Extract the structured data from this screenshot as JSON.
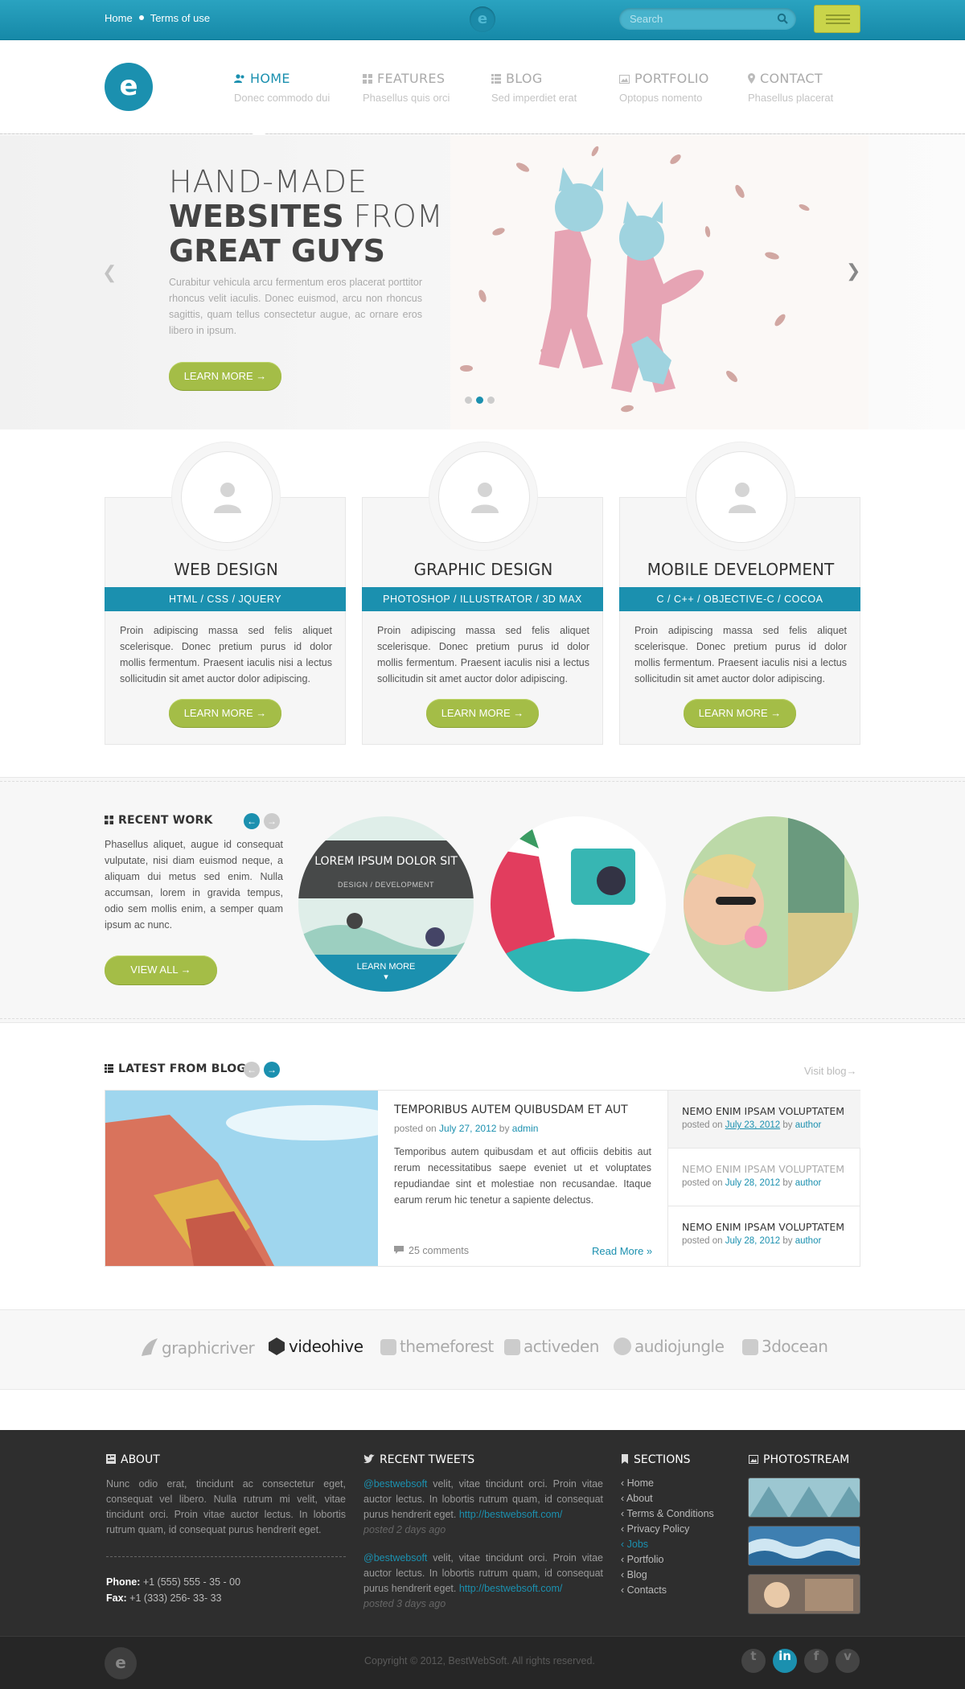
{
  "topbar": {
    "home": "Home",
    "terms": "Terms of use",
    "search_placeholder": "Search",
    "logo_letter": "e"
  },
  "header": {
    "logo_letter": "e"
  },
  "nav": [
    {
      "label": "HOME",
      "sub": "Donec commodo dui"
    },
    {
      "label": "FEATURES",
      "sub": "Phasellus quis orci"
    },
    {
      "label": "BLOG",
      "sub": "Sed imperdiet erat"
    },
    {
      "label": "PORTFOLIO",
      "sub": "Optopus nomento"
    },
    {
      "label": "CONTACT",
      "sub": "Phasellus placerat"
    }
  ],
  "slider": {
    "line1": "HAND-MADE",
    "line2_bold": "WEBSITES",
    "line2_rest": " FROM",
    "line3": "GREAT GUYS",
    "text": "Curabitur vehicula arcu fermentum eros placerat porttitor rhoncus velit iaculis. Donec euismod, arcu non rhoncus sagittis, quam tellus consectetur augue, ac ornare eros libero in ipsum.",
    "button": "LEARN MORE →"
  },
  "services": [
    {
      "title": "WEB DESIGN",
      "tags": "HTML / CSS / JQUERY",
      "text": "Proin adipiscing massa sed felis aliquet scelerisque. Donec pretium purus id dolor mollis fermentum. Praesent iaculis nisi a lectus sollicitudin sit amet auctor dolor adipiscing.",
      "button": "LEARN MORE →"
    },
    {
      "title": "GRAPHIC DESIGN",
      "tags": "PHOTOSHOP / ILLUSTRATOR / 3D MAX",
      "text": "Proin adipiscing massa sed felis aliquet scelerisque. Donec pretium purus id dolor mollis fermentum. Praesent iaculis nisi a lectus sollicitudin sit amet auctor dolor adipiscing.",
      "button": "LEARN MORE →"
    },
    {
      "title": "MOBILE DEVELOPMENT",
      "tags": "C / C++ / OBJECTIVE-C / COCOA",
      "text": "Proin adipiscing massa sed felis aliquet scelerisque. Donec pretium purus id dolor mollis fermentum. Praesent iaculis nisi a lectus sollicitudin sit amet auctor dolor adipiscing.",
      "button": "LEARN MORE →"
    }
  ],
  "recent_work": {
    "heading": "RECENT WORK",
    "text": "Phasellus aliquet, augue id consequat vulputate, nisi diam euismod neque, a aliquam dui metus sed enim. Nulla accumsan, lorem in gravida tempus, odio sem mollis enim, a semper quam ipsum ac nunc.",
    "button": "VIEW ALL →",
    "overlay_title": "LOREM IPSUM DOLOR SIT",
    "overlay_sub": "DESIGN / DEVELOPMENT",
    "overlay_button": "LEARN MORE"
  },
  "blog": {
    "heading": "LATEST FROM BLOG",
    "visit": "Visit blog→",
    "main": {
      "title": "TEMPORIBUS AUTEM QUIBUSDAM ET AUT",
      "posted_on": "posted on ",
      "date": "July 27, 2012",
      "by": " by ",
      "author": "admin",
      "text": "Temporibus autem quibusdam et aut officiis debitis aut rerum necessitatibus saepe eveniet ut et voluptates repudiandae sint et molestiae non recusandae. Itaque earum rerum hic tenetur a sapiente delectus.",
      "comments": "25 comments",
      "read_more": "Read More »"
    },
    "side": [
      {
        "title": "NEMO ENIM IPSAM VOLUPTATEM",
        "posted_on": "posted on ",
        "date": "July 23, 2012",
        "by": " by ",
        "author": "author"
      },
      {
        "title": "NEMO ENIM IPSAM VOLUPTATEM",
        "posted_on": "posted on ",
        "date": "July 28, 2012",
        "by": " by ",
        "author": "author"
      },
      {
        "title": "NEMO ENIM IPSAM VOLUPTATEM",
        "posted_on": "posted on ",
        "date": "July 28, 2012",
        "by": " by ",
        "author": "author"
      }
    ]
  },
  "brands": [
    "graphicriver",
    "videohive",
    "themeforest",
    "activeden",
    "audiojungle",
    "3docean"
  ],
  "footer": {
    "about": {
      "heading": "ABOUT",
      "text": "Nunc odio erat, tincidunt ac consectetur eget, consequat vel libero. Nulla rutrum mi velit, vitae tincidunt orci. Proin vitae auctor lectus. In lobortis rutrum quam, id consequat purus hendrerit eget.",
      "phone_label": "Phone:",
      "phone": " +1 (555) 555 - 35 - 00",
      "fax_label": "Fax:",
      "fax": " +1 (333) 256- 33- 33"
    },
    "tweets": {
      "heading": "RECENT TWEETS",
      "items": [
        {
          "handle": "@bestwebsoft",
          "text": " velit, vitae tincidunt orci. Proin vitae auctor lectus. In lobortis rutrum quam, id consequat purus hendrerit eget. ",
          "link": "http://bestwebsoft.com/",
          "time": "posted 2 days ago"
        },
        {
          "handle": "@bestwebsoft",
          "text": " velit, vitae tincidunt orci. Proin vitae auctor lectus. In lobortis rutrum quam, id consequat purus hendrerit eget. ",
          "link": "http://bestwebsoft.com/",
          "time": "posted 3 days ago"
        }
      ]
    },
    "sections": {
      "heading": "SECTIONS",
      "items": [
        "Home",
        "About",
        "Terms & Conditions",
        "Privacy Policy",
        "Jobs",
        "Portfolio",
        "Blog",
        "Contacts"
      ]
    },
    "photostream": {
      "heading": "PHOTOSTREAM"
    }
  },
  "bottom": {
    "copyright": "Copyright © 2012, BestWebSoft. All rights reserved.",
    "logo_letter": "e",
    "social_icons": [
      "twitter-icon",
      "linkedin-icon",
      "facebook-icon",
      "vimeo-icon"
    ]
  },
  "colors": {
    "accent": "#1b90af",
    "green": "#a4bd47",
    "dark": "#2e2e2e"
  }
}
